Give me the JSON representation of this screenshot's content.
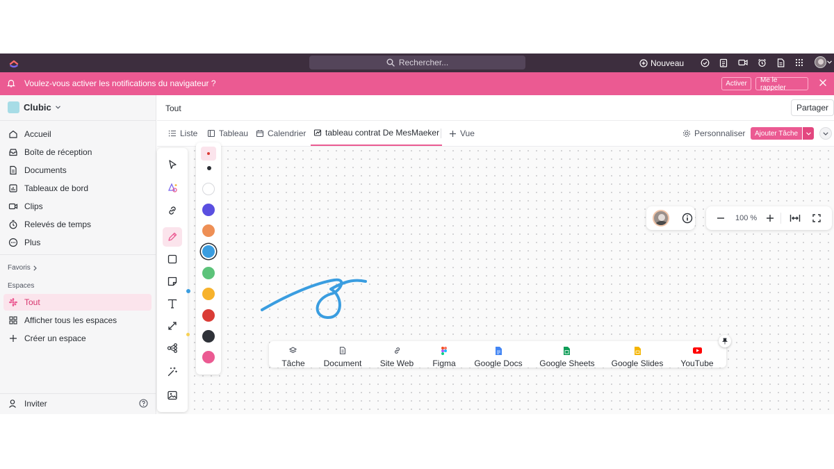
{
  "topbar": {
    "search_placeholder": "Rechercher...",
    "new_label": "Nouveau"
  },
  "notification": {
    "message": "Voulez-vous activer les notifications du navigateur ?",
    "activate_label": "Activer",
    "remind_label": "Me le rappeler"
  },
  "sidebar": {
    "workspace_name": "Clubic",
    "items": [
      {
        "label": "Accueil",
        "icon": "home-icon"
      },
      {
        "label": "Boîte de réception",
        "icon": "inbox-icon"
      },
      {
        "label": "Documents",
        "icon": "document-icon"
      },
      {
        "label": "Tableaux de bord",
        "icon": "dashboard-icon"
      },
      {
        "label": "Clips",
        "icon": "video-icon"
      },
      {
        "label": "Relevés de temps",
        "icon": "timer-icon"
      },
      {
        "label": "Plus",
        "icon": "more-icon"
      }
    ],
    "favorites_label": "Favoris",
    "spaces_label": "Espaces",
    "spaces": [
      {
        "label": "Tout",
        "icon": "asterisk-icon",
        "active": true
      },
      {
        "label": "Afficher tous les espaces",
        "icon": "grid-icon"
      },
      {
        "label": "Créer un espace",
        "icon": "plus-icon"
      }
    ],
    "invite_label": "Inviter"
  },
  "header": {
    "title": "Tout",
    "share_label": "Partager"
  },
  "views": {
    "tabs": [
      {
        "label": "Liste",
        "icon": "list-icon"
      },
      {
        "label": "Tableau",
        "icon": "board-icon"
      },
      {
        "label": "Calendrier",
        "icon": "calendar-icon"
      },
      {
        "label": "tableau contrat De MesMaeker",
        "icon": "whiteboard-icon",
        "active": true
      }
    ],
    "add_view_label": "Vue",
    "customize_label": "Personnaliser",
    "add_task_label": "Ajouter Tâche"
  },
  "canvas": {
    "zoom_label": "100 %",
    "palette": [
      "#ffffff",
      "#5a4fe0",
      "#ee8f55",
      "#3a9de0",
      "#5cc37a",
      "#f7b22c",
      "#da3c36",
      "#2f3239",
      "#eb5a92"
    ],
    "selected_color": "#3a9de0",
    "stroke_color": "#3a9de0"
  },
  "dock": [
    {
      "label": "Tâche",
      "icon": "task-icon"
    },
    {
      "label": "Document",
      "icon": "doc-icon"
    },
    {
      "label": "Site Web",
      "icon": "link-icon"
    },
    {
      "label": "Figma",
      "icon": "figma-icon"
    },
    {
      "label": "Google Docs",
      "icon": "google-docs-icon"
    },
    {
      "label": "Google Sheets",
      "icon": "google-sheets-icon"
    },
    {
      "label": "Google Slides",
      "icon": "google-slides-icon"
    },
    {
      "label": "YouTube",
      "icon": "youtube-icon"
    }
  ],
  "colors": {
    "brand_pink": "#eb5a92",
    "topbar": "#3d2e3e"
  }
}
